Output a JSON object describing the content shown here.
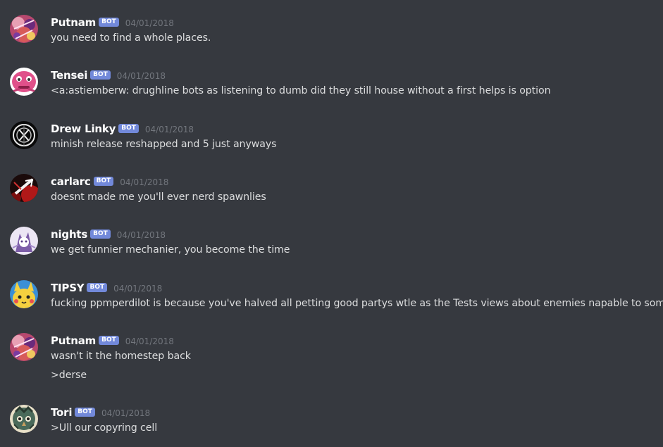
{
  "messages": [
    {
      "username": "Putnam",
      "badge": "BOT",
      "timestamp": "04/01/2018",
      "avatar": "putnam-avatar",
      "lines": [
        "you need to find a whole places."
      ]
    },
    {
      "username": "Tensei",
      "badge": "BOT",
      "timestamp": "04/01/2018",
      "avatar": "tensei-avatar",
      "lines": [
        "<a:astiemberw: drughline bots as listening to dumb did they still house without a first helps is option"
      ]
    },
    {
      "username": "Drew Linky",
      "badge": "BOT",
      "timestamp": "04/01/2018",
      "avatar": "drew-linky-avatar",
      "lines": [
        "minish release reshapped and 5 just anyways"
      ]
    },
    {
      "username": "carlarc",
      "badge": "BOT",
      "timestamp": "04/01/2018",
      "avatar": "carlarc-avatar",
      "lines": [
        "doesnt made me you'll ever nerd spawnlies"
      ]
    },
    {
      "username": "nights",
      "badge": "BOT",
      "timestamp": "04/01/2018",
      "avatar": "nights-avatar",
      "lines": [
        "we get funnier mechanier, you become the time"
      ]
    },
    {
      "username": "TIPSY",
      "badge": "BOT",
      "timestamp": "04/01/2018",
      "avatar": "tipsy-avatar",
      "lines": [
        "fucking ppmperdilot is because you've halved all petting good partys wtle as the Tests views about enemies napable to some"
      ]
    },
    {
      "username": "Putnam",
      "badge": "BOT",
      "timestamp": "04/01/2018",
      "avatar": "putnam-avatar",
      "lines": [
        "wasn't it the homestep back",
        ">derse"
      ]
    },
    {
      "username": "Tori",
      "badge": "BOT",
      "timestamp": "04/01/2018",
      "avatar": "tori-avatar",
      "lines": [
        ">Ull our copyring cell"
      ]
    }
  ],
  "colors": {
    "background": "#36393f",
    "username": "#ffffff",
    "message_text": "#dcddde",
    "timestamp": "#72767d",
    "bot_badge": "#7289da"
  }
}
